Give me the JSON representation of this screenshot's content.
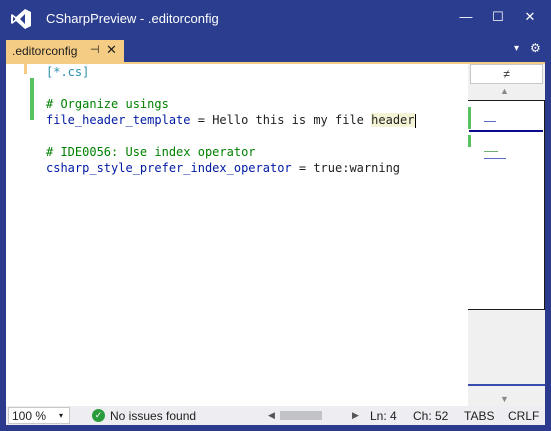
{
  "window": {
    "title": "CSharpPreview - .editorconfig",
    "minimize": "—",
    "maximize": "☐",
    "close": "✕"
  },
  "tab": {
    "label": ".editorconfig",
    "pin_icon": "⊣",
    "close_icon": "✕"
  },
  "toolbar": {
    "dropdown_icon": "▾",
    "settings_icon": "⚙"
  },
  "editor": {
    "lines": [
      {
        "text": "[*.cs]"
      },
      {
        "text": ""
      },
      {
        "text": "# Organize usings"
      },
      {
        "key": "file_header_template",
        "op": " = ",
        "value": "Hello this is my file ",
        "highlight": "header"
      },
      {
        "text": ""
      },
      {
        "text": "# IDE0056: Use index operator"
      },
      {
        "key": "csharp_style_prefer_index_operator",
        "op": " = ",
        "value": "true:warning"
      }
    ]
  },
  "map": {
    "split_icon": "≠",
    "up_icon": "▲",
    "down_icon": "▼"
  },
  "status": {
    "zoom": "100 %",
    "zoom_icon": "▾",
    "issue_icon": "✓",
    "issues": "No issues found",
    "scroll_left": "◀",
    "scroll_right": "▶",
    "line": "Ln: 4",
    "column": "Ch: 52",
    "indent": "TABS",
    "eol": "CRLF"
  },
  "colors": {
    "title_bg": "#2b3d8f",
    "tab_active": "#f5cc84",
    "change_marker": "#57c25f",
    "comment": "#008000",
    "section": "#2b91af",
    "key": "#001aa3"
  }
}
